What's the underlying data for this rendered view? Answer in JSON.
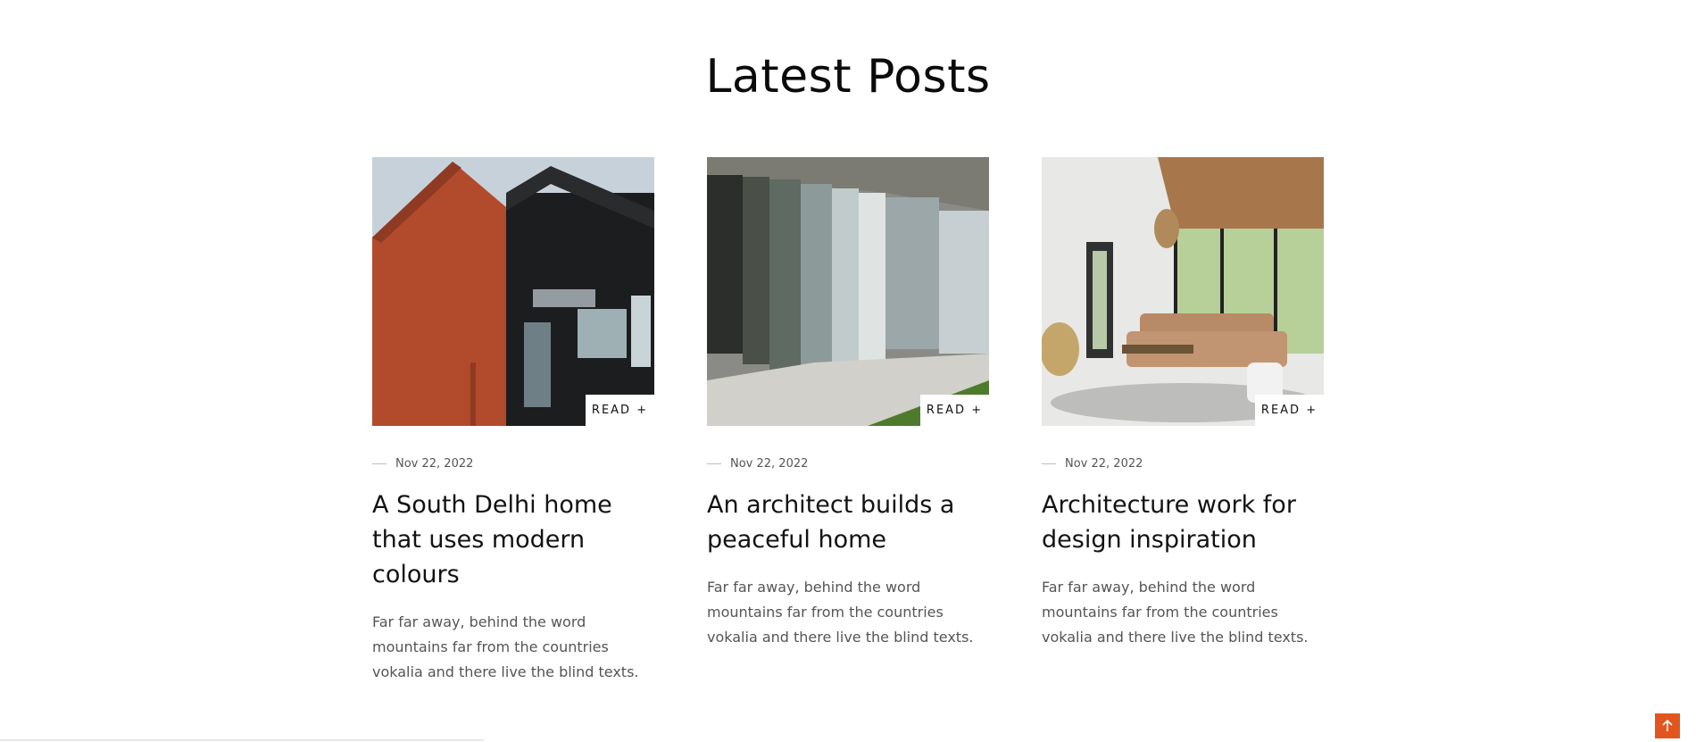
{
  "section": {
    "title": "Latest Posts"
  },
  "posts": [
    {
      "read_label": "READ +",
      "date": "Nov 22, 2022",
      "title": "A South Delhi home that uses modern colours",
      "excerpt": "Far far away, behind the word mountains far from the countries vokalia and there live the blind texts."
    },
    {
      "read_label": "READ +",
      "date": "Nov 22, 2022",
      "title": "An architect builds a peaceful home",
      "excerpt": "Far far away, behind the word mountains far from the countries vokalia and there live the blind texts."
    },
    {
      "read_label": "READ +",
      "date": "Nov 22, 2022",
      "title": "Architecture work for design inspiration",
      "excerpt": "Far far away, behind the word mountains far from the countries vokalia and there live the blind texts."
    }
  ],
  "scroll_progress_percent": 28.5,
  "icons": {
    "back_to_top": "arrow-up-icon"
  },
  "colors": {
    "accent": "#e2551e",
    "text": "#121212",
    "muted": "#555555"
  }
}
